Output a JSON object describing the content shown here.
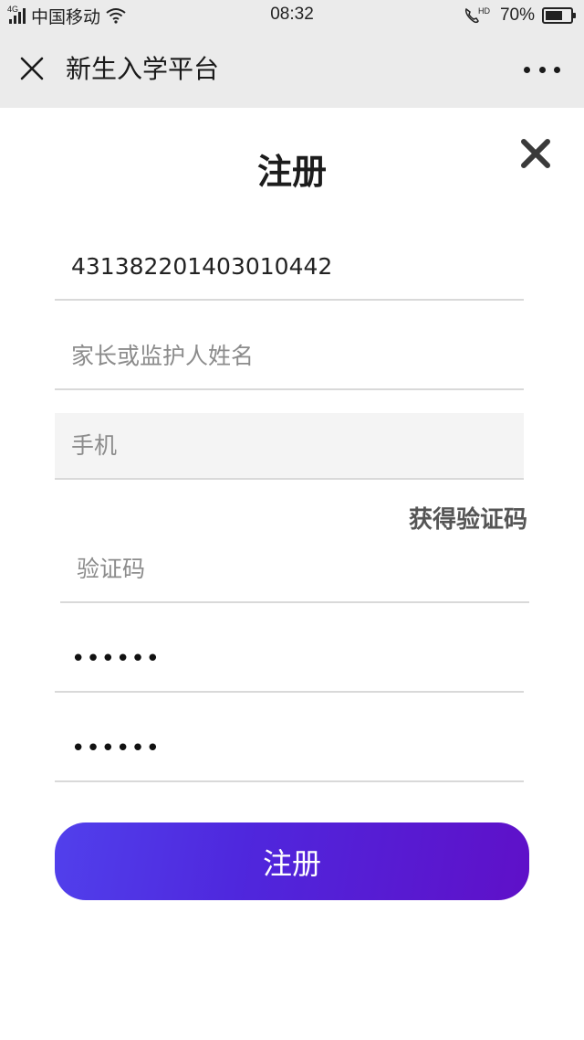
{
  "status_bar": {
    "network": "4G",
    "carrier": "中国移动",
    "time": "08:32",
    "call_badge": "HD",
    "battery_percent": "70%",
    "battery_level": 0.7
  },
  "title_bar": {
    "title": "新生入学平台"
  },
  "form": {
    "title": "注册",
    "id_value": "431382201403010442",
    "guardian_placeholder": "家长或监护人姓名",
    "phone_placeholder": "手机",
    "get_code_label": "获得验证码",
    "code_placeholder": "验证码",
    "password_value": "123456",
    "confirm_password_value": "123456",
    "submit_label": "注册"
  },
  "colors": {
    "bar_bg": "#ebebeb",
    "button_gradient_start": "#5140ec",
    "button_gradient_end": "#5f10c8",
    "divider": "#d9d9d9"
  }
}
